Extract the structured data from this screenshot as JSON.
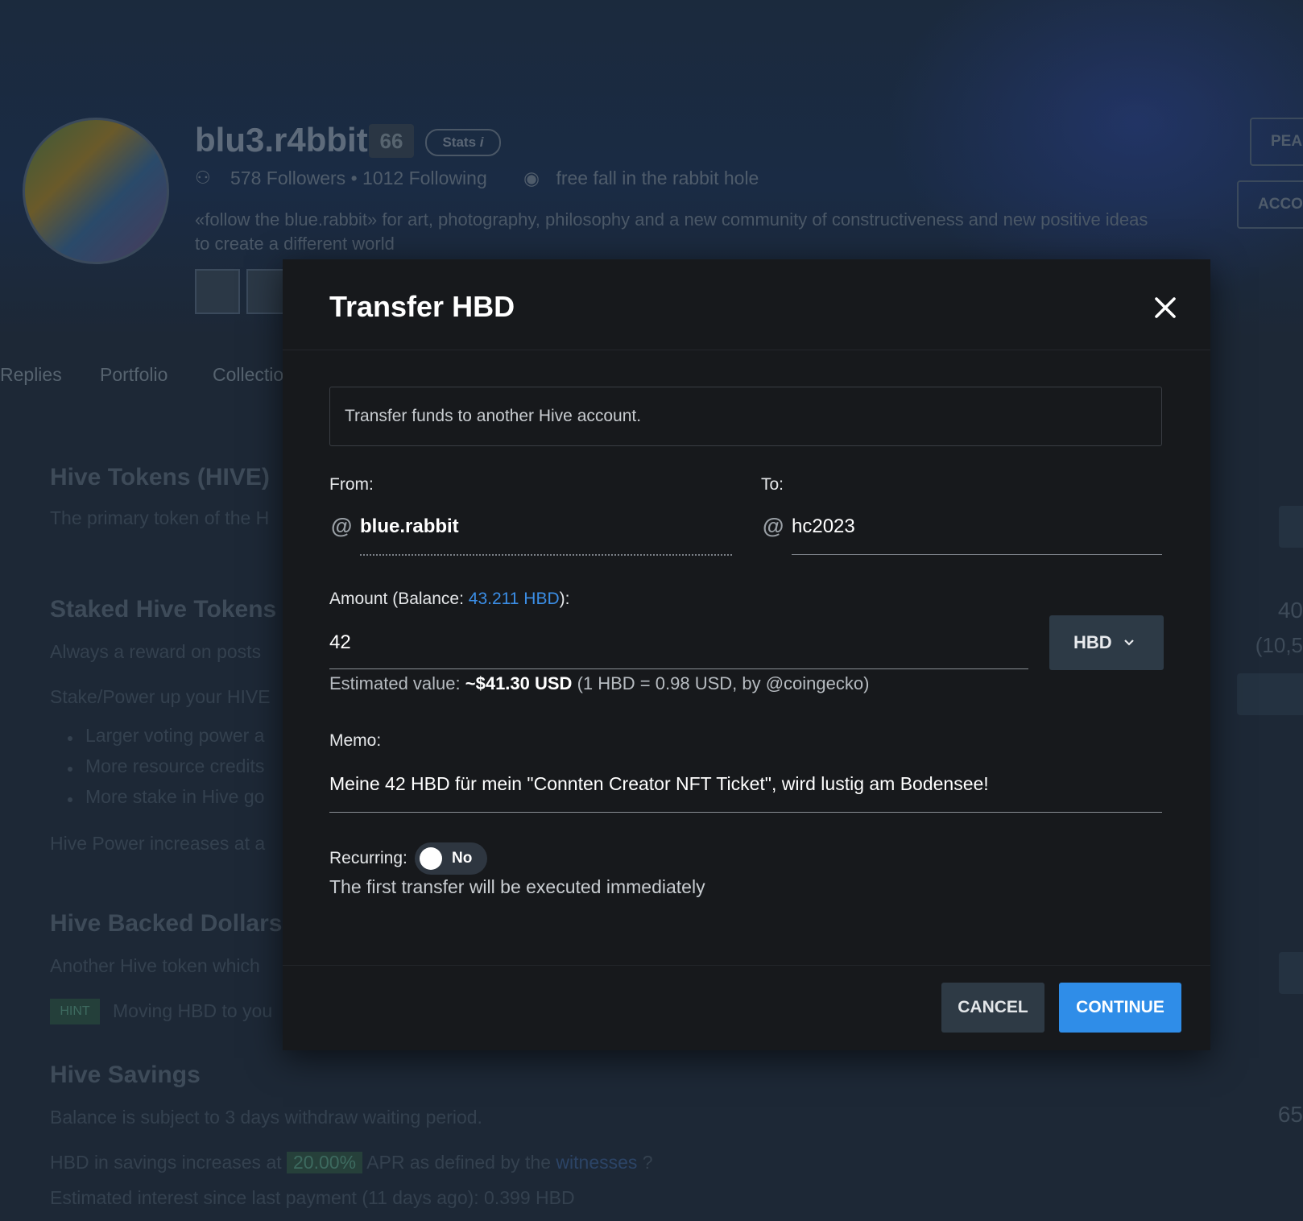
{
  "profile": {
    "name": "blu3.r4bbit",
    "reputation": "66",
    "stats_label": "Stats",
    "followers": "578 Followers",
    "following": "1012 Following",
    "location": "free fall in the rabbit hole",
    "bio_line1": "«follow the blue.rabbit» for art, photography, philosophy and a new community of constructiveness and new positive ideas",
    "bio_line2": "to create a different world",
    "side_buttons": [
      "PEA",
      "ACCO"
    ]
  },
  "nav_tabs": [
    "Replies",
    "Portfolio",
    "Collectio"
  ],
  "wallet_bg": {
    "hive_title": "Hive Tokens (HIVE)",
    "hive_desc": "The primary token of the H",
    "staked_title": "Staked Hive Tokens -",
    "staked_desc": "Always a reward on posts",
    "stake_line": "Stake/Power up your HIVE",
    "bullets": [
      "Larger voting power a",
      "More resource credits",
      "More stake in Hive go"
    ],
    "hp_line": "Hive Power increases at a",
    "hbd_title": "Hive Backed Dollars (",
    "hbd_desc": "Another Hive token which",
    "hint_badge": "HINT",
    "hint_text": "Moving HBD to you",
    "savings_title": "Hive Savings",
    "savings_desc": "Balance is subject to 3 days withdraw waiting period.",
    "apr_pre": "HBD in savings increases at",
    "apr_value": "20.00%",
    "apr_post": "APR as defined by the",
    "witnesses": "witnesses",
    "interest_line": "Estimated interest since last payment (11 days ago): 0.399 HBD",
    "right_num_1": "40",
    "right_num_2": "(10,5",
    "right_num_3": "65"
  },
  "modal": {
    "title": "Transfer HBD",
    "info": "Transfer funds to another Hive account.",
    "from_label": "From:",
    "from_value": "blue.rabbit",
    "to_label": "To:",
    "to_value": "hc2023",
    "amount_label_pre": "Amount (Balance: ",
    "balance": "43.211 HBD",
    "amount_label_post": "):",
    "amount_value": "42",
    "currency": "HBD",
    "estimated_pre": "Estimated value: ",
    "estimated_value": "~$41.30 USD",
    "estimated_post": " (1 HBD = 0.98 USD, by @coingecko)",
    "memo_label": "Memo:",
    "memo_value": "Meine 42 HBD für mein \"Connten Creator NFT Ticket\", wird lustig am Bodensee!",
    "recurring_label": "Recurring:",
    "recurring_toggle": "No",
    "first_transfer_note": "The first transfer will be executed immediately",
    "cancel_label": "CANCEL",
    "continue_label": "CONTINUE"
  },
  "colors": {
    "accent": "#2f8de8",
    "link": "#3b8ee6",
    "modal_bg": "#17191c",
    "page_bg": "#1d2836"
  },
  "icons": [
    "close-icon",
    "at-icon",
    "chevron-down-icon",
    "location-icon",
    "followers-icon",
    "info-icon",
    "help-icon"
  ]
}
